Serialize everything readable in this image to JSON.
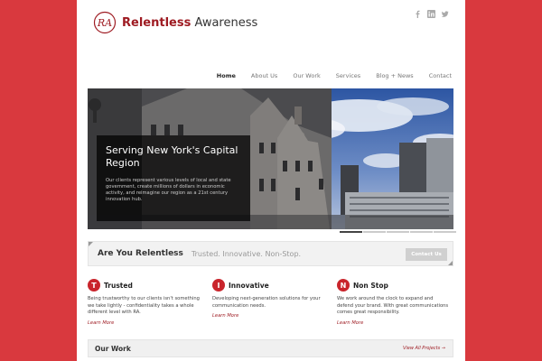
{
  "brand": {
    "name_bold": "Relentless",
    "name_rest": " Awareness",
    "monogram": "RA"
  },
  "social": [
    {
      "icon": "facebook-icon"
    },
    {
      "icon": "linkedin-icon"
    },
    {
      "icon": "twitter-icon"
    }
  ],
  "nav": {
    "items": [
      {
        "label": "Home",
        "active": true
      },
      {
        "label": "About Us"
      },
      {
        "label": "Our Work"
      },
      {
        "label": "Services"
      },
      {
        "label": "Blog + News"
      },
      {
        "label": "Contact"
      }
    ]
  },
  "hero": {
    "title": "Serving New York's Capital Region",
    "body": "Our clients represent various levels of local and state government, create millions of dollars in economic activity, and reimagine our region as a 21st century innovation hub.",
    "slides_total": 5,
    "slide_active": 1
  },
  "tagline": {
    "heading": "Are You Relentless",
    "sub": "Trusted. Innovative. Non-Stop.",
    "button": "Contact Us"
  },
  "features": [
    {
      "letter": "T",
      "title": "Trusted",
      "desc": "Being trustworthy to our clients isn't something we take lightly - confidentiality takes a whole different level with RA.",
      "link": "Learn More"
    },
    {
      "letter": "I",
      "title": "Innovative",
      "desc": "Developing next-generation solutions for your communication needs.",
      "link": "Learn More"
    },
    {
      "letter": "N",
      "title": "Non Stop",
      "desc": "We work around the clock to expand and defend your brand. With great communications comes great responsibility.",
      "link": "Learn More"
    }
  ],
  "work": {
    "title": "Our Work",
    "link": "View All Projects →"
  },
  "colors": {
    "background": "#d9393e",
    "accent": "#c9252c",
    "brand": "#9e1b22"
  }
}
